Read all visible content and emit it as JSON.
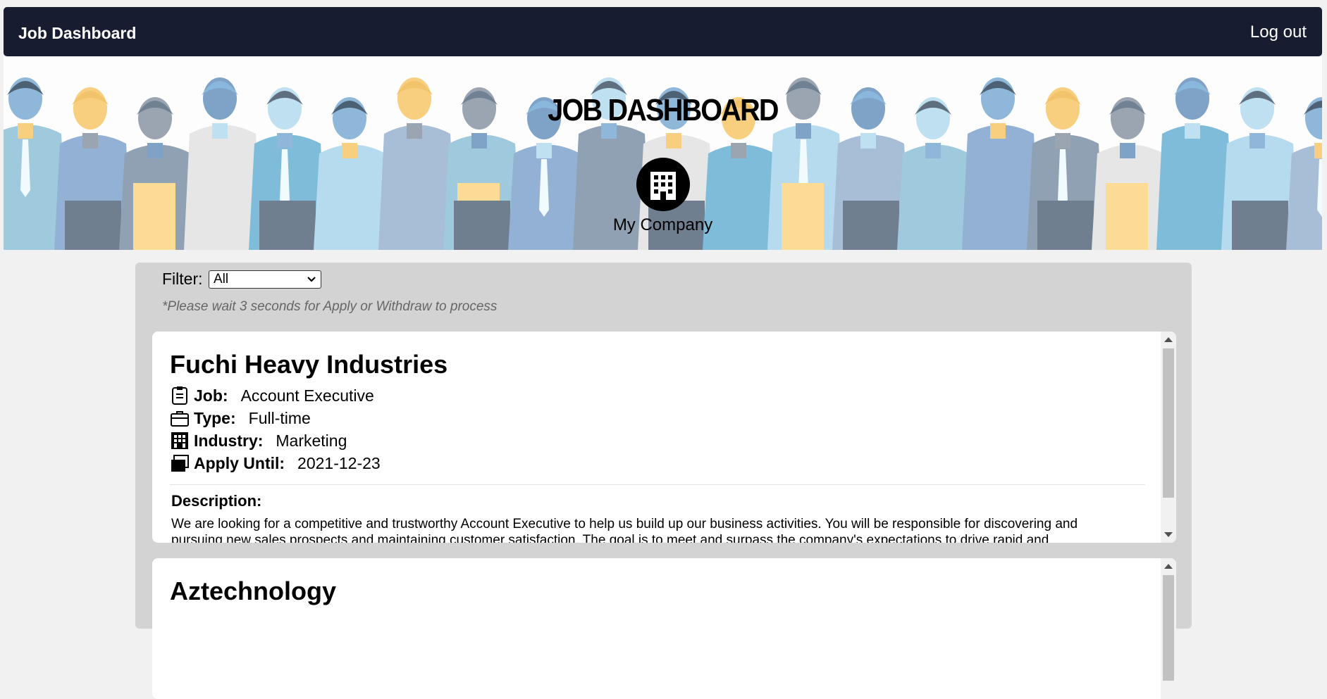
{
  "navbar": {
    "title": "Job Dashboard",
    "logout_label": "Log out"
  },
  "hero": {
    "title": "JOB DASHBOARD",
    "company_name": "My Company",
    "avatar_icon": "building-icon"
  },
  "filter": {
    "label": "Filter:",
    "selected": "All"
  },
  "note": "*Please wait 3 seconds for Apply or Withdraw to process",
  "jobs": [
    {
      "company": "Fuchi Heavy Industries",
      "job_label": "Job:",
      "job": "Account Executive",
      "type_label": "Type:",
      "type": "Full-time",
      "industry_label": "Industry:",
      "industry": "Marketing",
      "apply_label": "Apply Until:",
      "apply_until": "2021-12-23",
      "description_label": "Description:",
      "description": "We are looking for a competitive and trustworthy Account Executive to help us build up our business activities. You will be responsible for discovering and pursuing new sales prospects and maintaining customer satisfaction. The goal is to meet and surpass the company's expectations to drive rapid and"
    },
    {
      "company": "Aztechnology"
    }
  ],
  "colors": {
    "navbar": "#171c31",
    "panel": "#d3d3d3",
    "page": "#f1f1f1"
  }
}
